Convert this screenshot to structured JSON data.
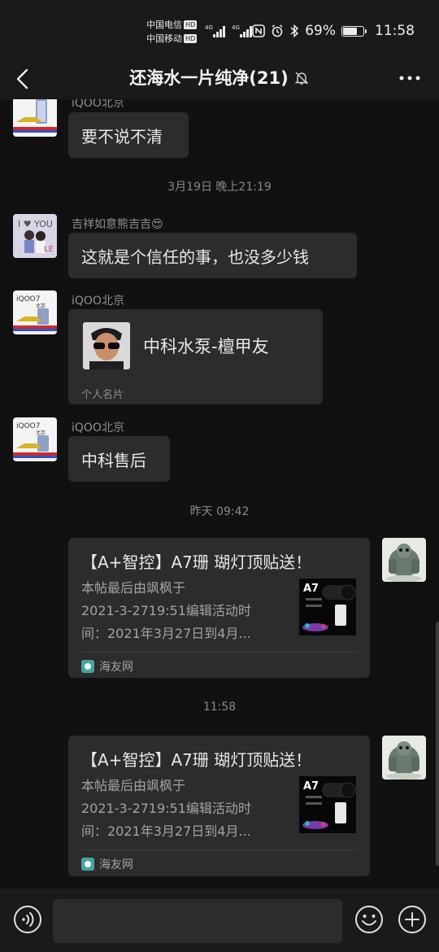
{
  "status_bar": {
    "carrier_1": "中国电信",
    "carrier_2": "中国移动",
    "hd_label": "HD",
    "network_1": "4G",
    "network_2": "4G",
    "battery_percent": "69%",
    "battery_level": 0.69,
    "time": "11:58",
    "icons": [
      "nfc-icon",
      "alarm-icon",
      "bluetooth-icon"
    ]
  },
  "header": {
    "title": "还海水一片纯净(21)",
    "back_icon": "chevron-left-icon",
    "mute_icon": "bell-off-icon",
    "more_icon": "more-horizontal-icon"
  },
  "messages": {
    "m1": {
      "sender": "iQOO北京",
      "text": "要不说不清"
    },
    "time_1": "3月19日 晚上21:19",
    "m2": {
      "sender": "吉祥如意熊吉吉😍",
      "text": "这就是个信任的事，也没多少钱"
    },
    "m3": {
      "sender": "iQOO北京",
      "card_name": "中科水泵-檀甲友",
      "card_label": "个人名片"
    },
    "m4": {
      "sender": "iQOO北京",
      "text": "中科售后"
    },
    "time_2": "昨天 09:42",
    "m5": {
      "title": "【A+智控】A7珊 瑚灯顶贴送！",
      "desc_line_1": "本帖最后由飒枫于",
      "desc_line_2": "2021-3-2719:51编辑活动时",
      "desc_line_3": "间：2021年3月27日到4月...",
      "thumb_text": "A7",
      "source": "海友网"
    },
    "time_3": "11:58",
    "m6": {
      "title": "【A+智控】A7珊 瑚灯顶贴送！",
      "desc_line_1": "本帖最后由飒枫于",
      "desc_line_2": "2021-3-2719:51编辑活动时",
      "desc_line_3": "间：2021年3月27日到4月...",
      "thumb_text": "A7",
      "source": "海友网"
    }
  },
  "avatar_text": {
    "iqoo": "iQOO7",
    "iqoo_sub": "北京"
  },
  "input_bar": {
    "voice_icon": "voice-icon",
    "emoji_icon": "emoji-icon",
    "plus_icon": "plus-icon",
    "input_value": ""
  }
}
